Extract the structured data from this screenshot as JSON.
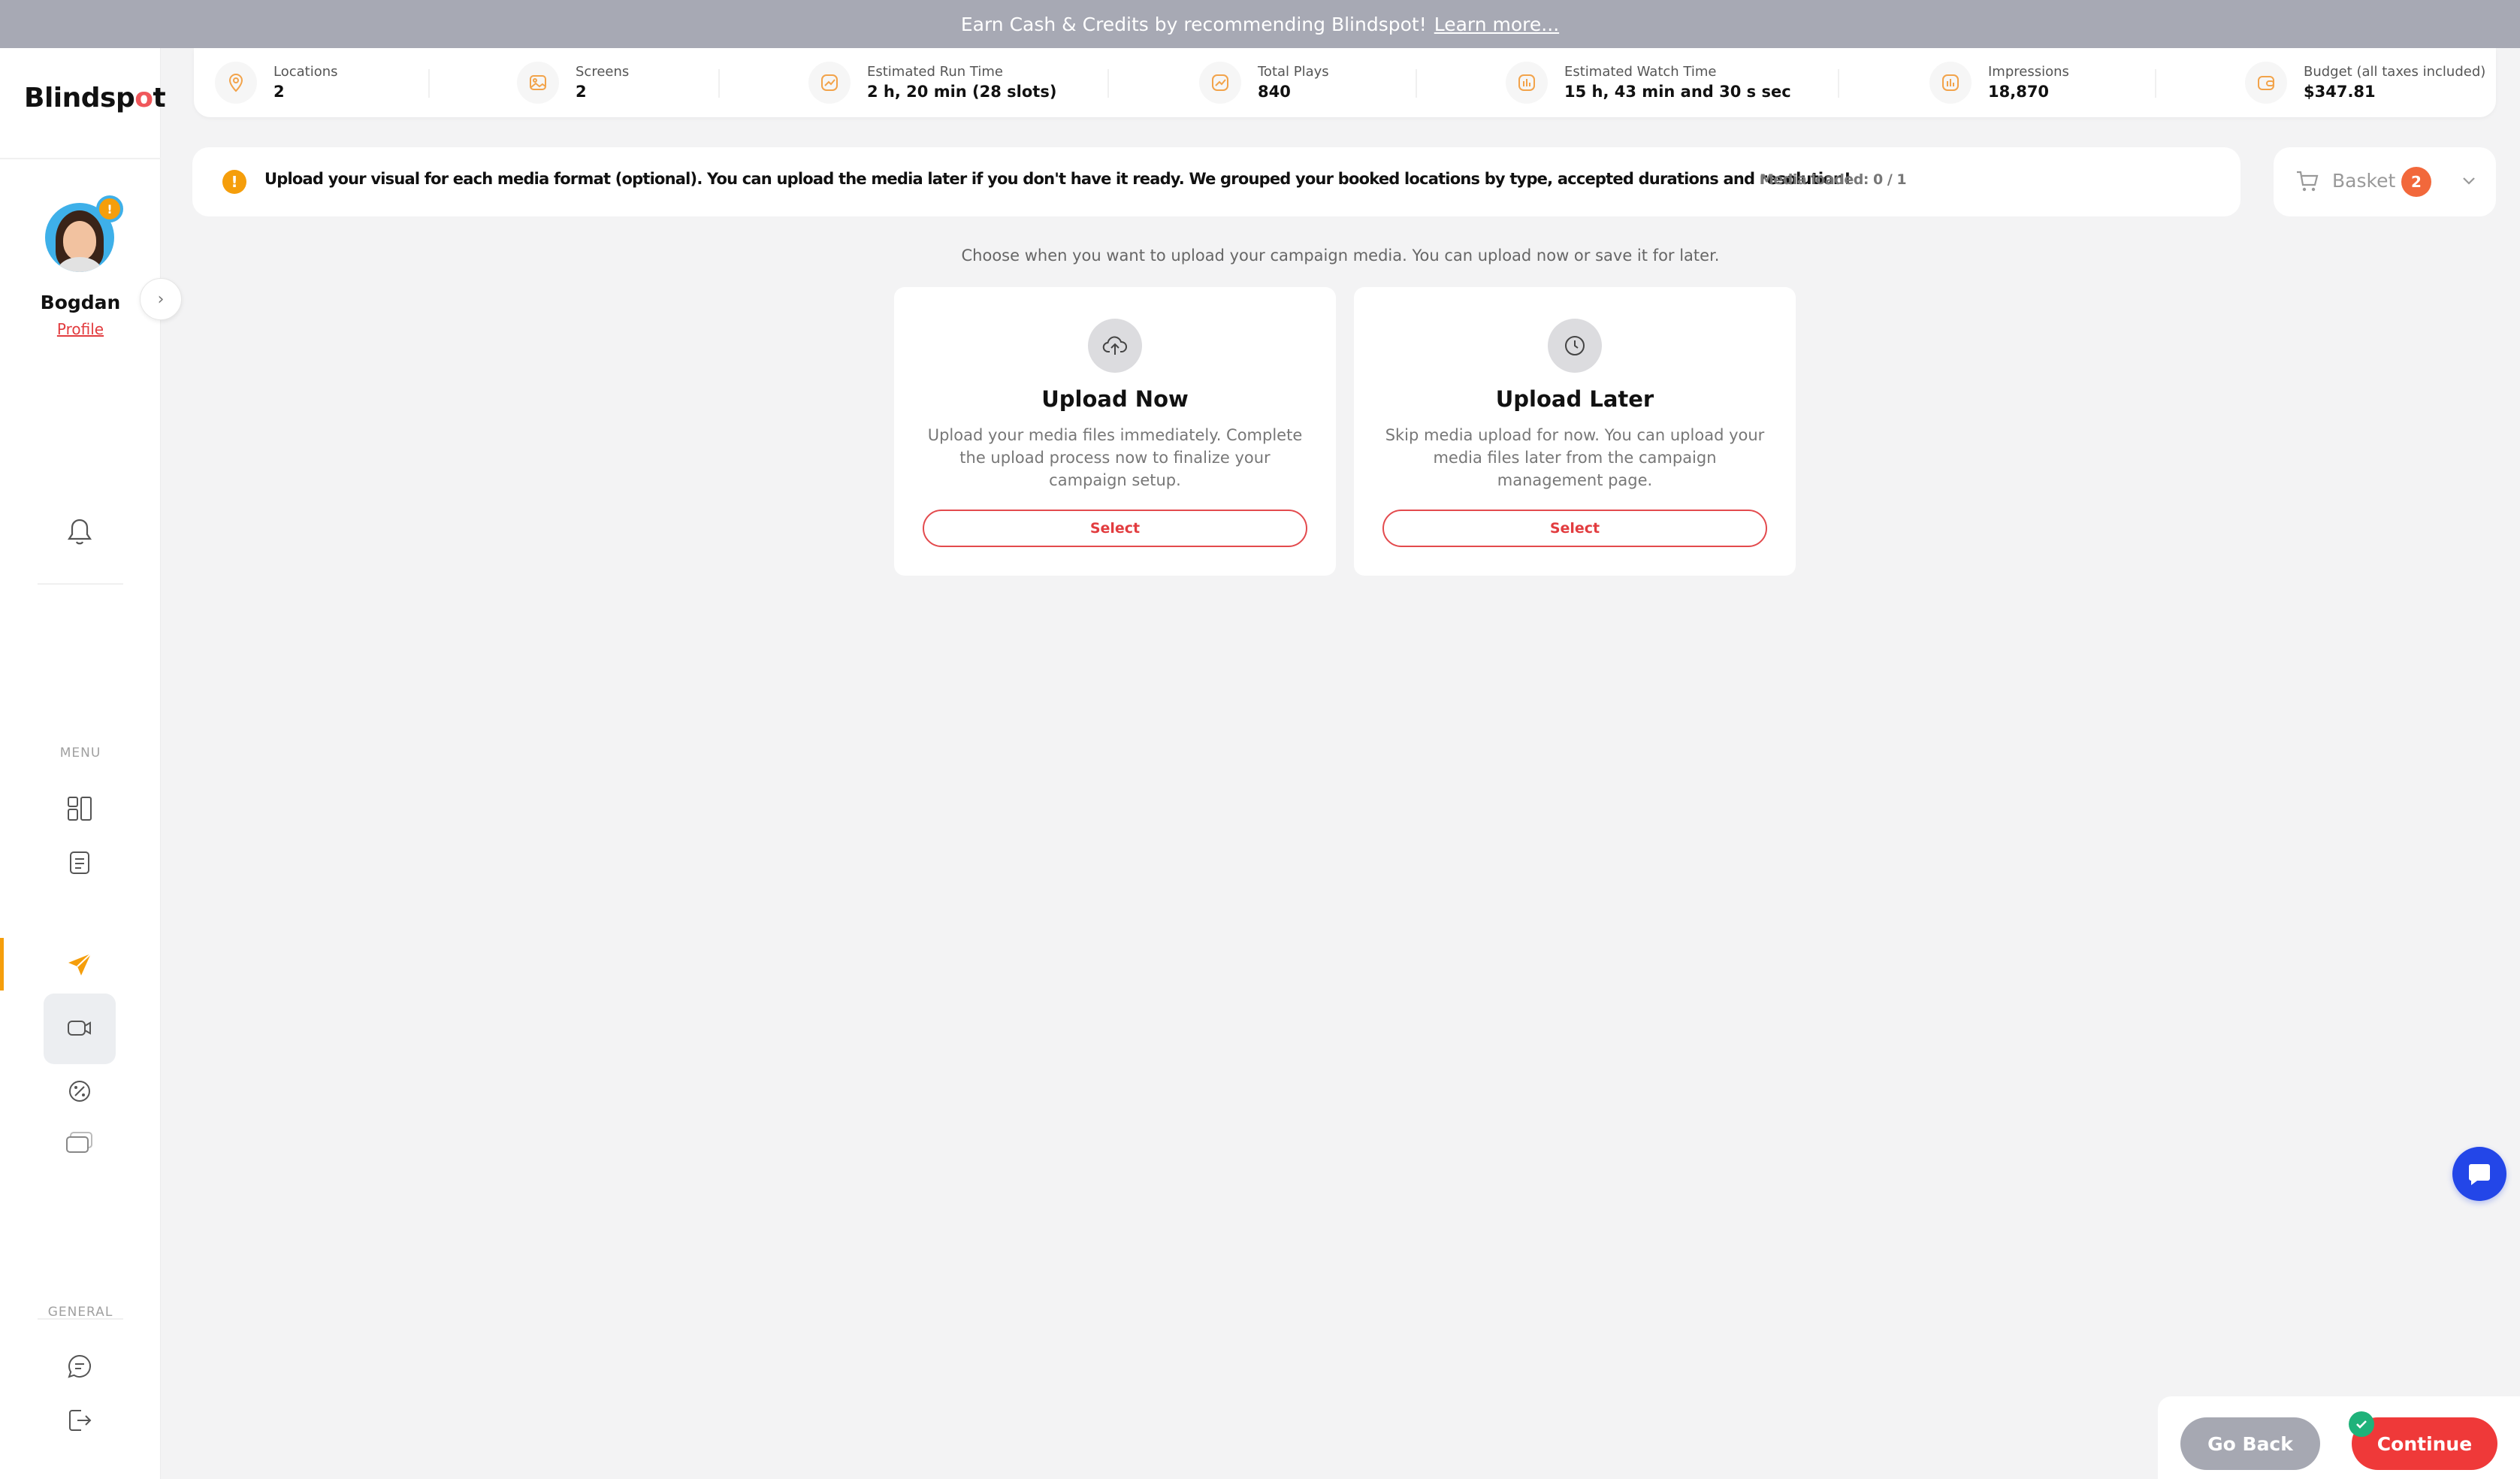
{
  "promo": {
    "text": "Earn Cash & Credits by recommending Blindspot!",
    "link": "Learn more..."
  },
  "logo": {
    "prefix": "Blindsp",
    "dot": "o",
    "suffix": "t"
  },
  "user": {
    "name": "Bogdan",
    "profile_link": "Profile",
    "badge": "!"
  },
  "sidebar": {
    "menu_label": "MENU",
    "general_label": "GENERAL",
    "menu_icons": [
      "dashboard-icon",
      "document-icon",
      "send-icon",
      "video-icon",
      "discount-icon",
      "chat-bubbles-icon"
    ],
    "general_icons": [
      "message-icon",
      "logout-icon"
    ],
    "notification_icon": "bell-icon"
  },
  "stats": [
    {
      "label": "Locations",
      "value": "2",
      "icon": "location-pin-icon"
    },
    {
      "label": "Screens",
      "value": "2",
      "icon": "image-icon"
    },
    {
      "label": "Estimated Run Time",
      "value": "2 h, 20 min (28 slots)",
      "icon": "trend-up-icon"
    },
    {
      "label": "Total Plays",
      "value": "840",
      "icon": "trend-up-icon"
    },
    {
      "label": "Estimated Watch Time",
      "value": "15 h, 43 min and 30 s sec",
      "icon": "bar-chart-icon"
    },
    {
      "label": "Impressions",
      "value": "18,870",
      "icon": "bar-chart-icon"
    },
    {
      "label": "Budget (all taxes included)",
      "value": "$347.81",
      "icon": "wallet-icon"
    }
  ],
  "info": {
    "icon": "!",
    "text": "Upload your visual for each media format (optional).  You can upload the media later if you don't have it ready.  We grouped your booked locations by type, accepted durations and resolution!",
    "media_loaded": "Media loaded: 0 / 1"
  },
  "basket": {
    "label": "Basket",
    "count": "2"
  },
  "main": {
    "subtitle": "Choose when you want to upload your campaign media. You can upload now or save it for later.",
    "options": [
      {
        "title": "Upload Now",
        "description": "Upload your media files immediately. Complete the upload process now to finalize your campaign setup.",
        "button": "Select",
        "icon": "cloud-upload-icon"
      },
      {
        "title": "Upload Later",
        "description": "Skip media upload for now. You can upload your media files later from the campaign management page.",
        "button": "Select",
        "icon": "clock-icon"
      }
    ]
  },
  "footer": {
    "back": "Go Back",
    "continue": "Continue"
  },
  "colors": {
    "accent": "#ef3939",
    "orange": "#f59e0b",
    "basket_badge": "#f2683b",
    "chat": "#2346e8",
    "check": "#1fb27a"
  }
}
